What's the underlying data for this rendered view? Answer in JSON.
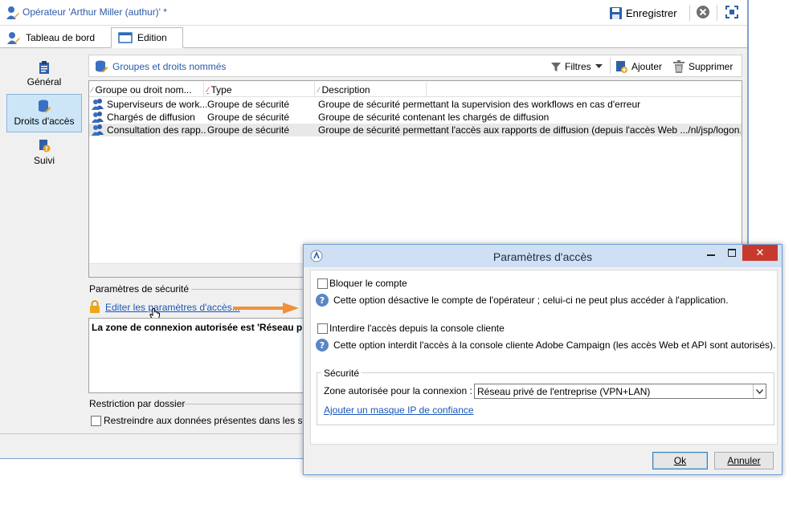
{
  "window": {
    "title": "Opérateur 'Arthur Miller (authur)' *",
    "save_label": "Enregistrer"
  },
  "tabs": [
    {
      "label": "Tableau de bord"
    },
    {
      "label": "Edition"
    }
  ],
  "sidebar": {
    "items": [
      {
        "label": "Général"
      },
      {
        "label": "Droits d'accès"
      },
      {
        "label": "Suivi"
      }
    ]
  },
  "panel": {
    "title": "Groupes et droits nommés",
    "filters_label": "Filtres",
    "add_label": "Ajouter",
    "delete_label": "Supprimer"
  },
  "table": {
    "columns": [
      "Groupe ou droit nom...",
      "Type",
      "Description"
    ],
    "rows": [
      {
        "name": "Superviseurs de work...",
        "type": "Groupe de sécurité",
        "description": "Groupe de sécurité permettant la supervision des workflows en cas d'erreur"
      },
      {
        "name": "Chargés de diffusion",
        "type": "Groupe de sécurité",
        "description": "Groupe de sécurité contenant les chargés de diffusion"
      },
      {
        "name": "Consultation des rapp...",
        "type": "Groupe de sécurité",
        "description": "Groupe de sécurité permettant l'accès aux rapports de diffusion (depuis l'accès Web .../nl/jsp/logon.",
        "selected": true
      }
    ]
  },
  "security": {
    "section_label": "Paramètres de sécurité",
    "edit_link": "Editer les paramètres d'accès...",
    "zone_text": "La zone de connexion autorisée est 'Réseau priv"
  },
  "folder_restriction": {
    "section_label": "Restriction par dossier",
    "checkbox_label": "Restreindre aux données présentes dans les sou"
  },
  "dialog": {
    "title": "Paramètres d'accès",
    "block_account": {
      "label": "Bloquer le compte",
      "help": "Cette option désactive le compte de l'opérateur ; celui-ci ne peut plus accéder à l'application.",
      "checked": false
    },
    "block_console": {
      "label": "Interdire l'accès depuis la console cliente",
      "help": "Cette option interdit l'accès à la console cliente Adobe Campaign (les accès Web et API sont autorisés).",
      "checked": false
    },
    "security_group": {
      "title": "Sécurité",
      "zone_label": "Zone autorisée pour la connexion :",
      "zone_value": "Réseau privé de l'entreprise (VPN+LAN)",
      "ip_mask_link": "Ajouter un masque IP de confiance"
    },
    "ok_label": "Ok",
    "cancel_label": "Annuler"
  },
  "colors": {
    "accent": "#2a5aa8",
    "link": "#1a56b8",
    "selection": "#cde6f7",
    "arrow": "#f0903c",
    "close": "#c7392c"
  }
}
